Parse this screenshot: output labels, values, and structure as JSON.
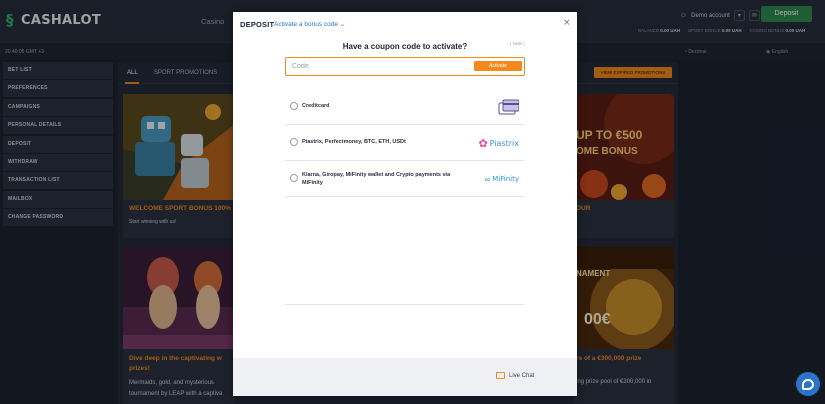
{
  "header": {
    "logo_text": "CASHALOT",
    "nav_casino": "Casino",
    "account_name": "Demo account",
    "deposit_label": "Deposit",
    "balances": [
      {
        "label": "BALANCE",
        "value": "0.00 UAH"
      },
      {
        "label": "SPORT BONUS",
        "value": "0.00 UAH"
      },
      {
        "label": "CASINO BONUS",
        "value": "0.00 UAH"
      }
    ]
  },
  "subbar": {
    "clock": "20:40:05 GMT +3",
    "odds_format": "Decimal",
    "language": "English"
  },
  "sidebar": {
    "items": [
      {
        "label": "BET LIST"
      },
      {
        "label": "PREFERENCES"
      },
      {
        "label": "CAMPAIGNS"
      },
      {
        "label": "PERSONAL DETAILS"
      },
      {
        "label": "DEPOSIT"
      },
      {
        "label": "WITHDRAW"
      },
      {
        "label": "TRANSACTION LIST"
      },
      {
        "label": "MAILBOX"
      },
      {
        "label": "CHANGE PASSWORD"
      }
    ]
  },
  "promotions": {
    "tabs": [
      {
        "label": "ALL",
        "active": true
      },
      {
        "label": "SPORT PROMOTIONS",
        "active": false
      }
    ],
    "view_expired": "VIEW EXPIRED PROMOTIONS",
    "cards": [
      {
        "title": "WELCOME SPORT BONUS 100%",
        "subtitle": "Start winning with us!"
      },
      {
        "title": "Dive deep in the captivating w",
        "title2": "prizes!",
        "subtitle": "Mermaids, gold, and mysterious",
        "subtitle2": "tournament by LEAP with a captiva"
      },
      {
        "title": "OUR",
        "banner": "UP TO €500",
        "banner2": "OME BONUS"
      },
      {
        "title": "rs of a €300,000 prize",
        "subtitle": "ing prize pool of €300,000 in",
        "banner": "NAMENT",
        "banner2": "00€"
      }
    ]
  },
  "deposit_modal": {
    "title": "DEPOSIT",
    "bonus_link": "Activate a bonus code",
    "coupon_prompt": "Have a coupon code to activate?",
    "hide_label": "( Hide )",
    "code_placeholder": "Code",
    "activate_label": "Activate",
    "methods": [
      {
        "label": "Creditcard",
        "logo": "credit-card"
      },
      {
        "label": "Piastrix, Perfectmoney, BTC, ETH, USDt",
        "logo": "Piastrix"
      },
      {
        "label": "Klarna, Giropay, MiFinity wallet and Crypto payments via",
        "label2": "MiFinity",
        "logo": "MiFinity"
      }
    ],
    "live_chat": "Live Chat"
  },
  "colors": {
    "accent": "#f08a1c",
    "brand_green": "#2e8b4e",
    "link_blue": "#2b73c9",
    "background": "#1c2230"
  }
}
